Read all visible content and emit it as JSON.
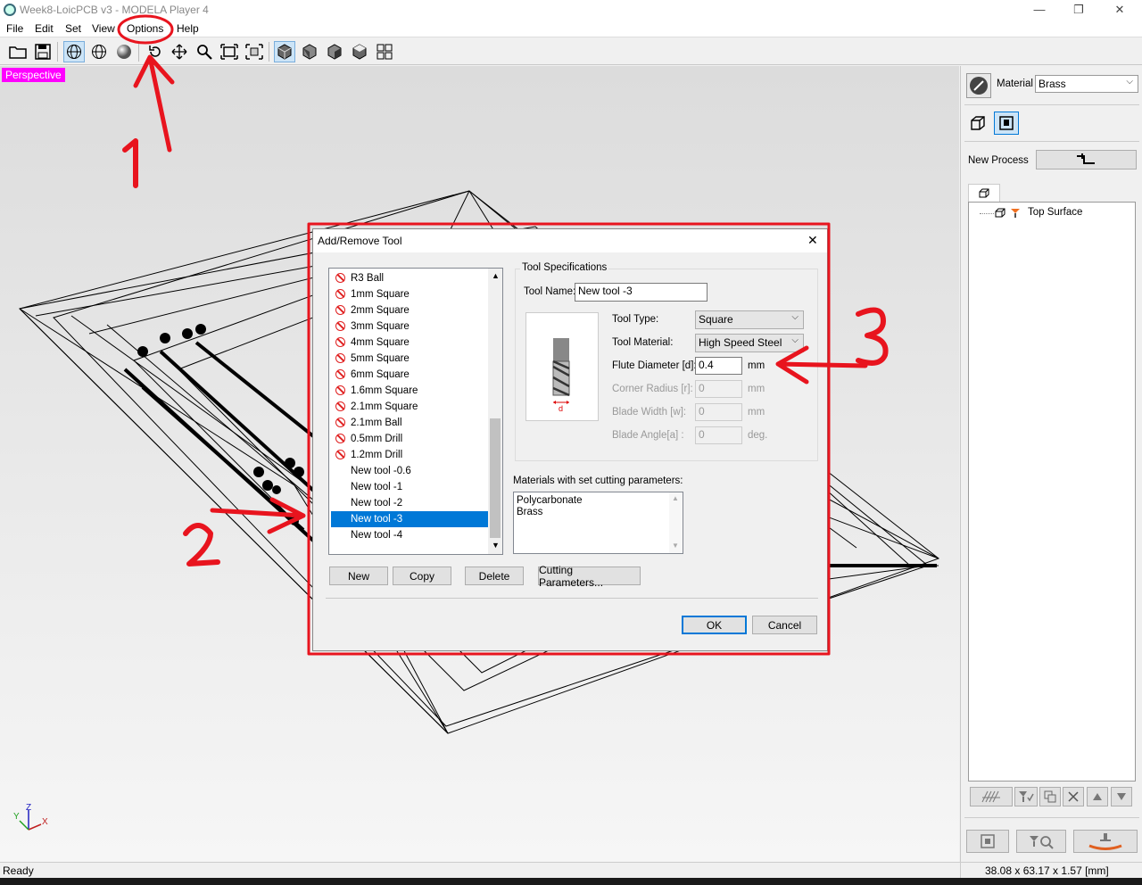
{
  "window": {
    "title": "Week8-LoicPCB v3 - MODELA Player 4",
    "controls": [
      "—",
      "❐",
      "✕"
    ]
  },
  "menu": [
    "File",
    "Edit",
    "Set",
    "View",
    "Options",
    "Help"
  ],
  "viewport": {
    "view_label": "Perspective",
    "axes": {
      "x": "X",
      "y": "Y",
      "z": "Z"
    }
  },
  "right_panel": {
    "material_label": "Material",
    "material_value": "Brass",
    "new_process_label": "New Process",
    "process_tree": [
      "Top Surface"
    ]
  },
  "dialog": {
    "title": "Add/Remove Tool",
    "close": "✕",
    "tools": [
      {
        "name": "R3 Ball",
        "restricted": true
      },
      {
        "name": "1mm Square",
        "restricted": true
      },
      {
        "name": "2mm Square",
        "restricted": true
      },
      {
        "name": "3mm Square",
        "restricted": true
      },
      {
        "name": "4mm Square",
        "restricted": true
      },
      {
        "name": "5mm Square",
        "restricted": true
      },
      {
        "name": "6mm Square",
        "restricted": true
      },
      {
        "name": "1.6mm Square",
        "restricted": true
      },
      {
        "name": "2.1mm Square",
        "restricted": true
      },
      {
        "name": "2.1mm Ball",
        "restricted": true
      },
      {
        "name": "0.5mm Drill",
        "restricted": true
      },
      {
        "name": "1.2mm Drill",
        "restricted": true
      },
      {
        "name": "New tool -0.6",
        "restricted": false
      },
      {
        "name": "New tool -1",
        "restricted": false
      },
      {
        "name": "New tool -2",
        "restricted": false
      },
      {
        "name": "New tool -3",
        "restricted": false,
        "selected": true
      },
      {
        "name": "New tool -4",
        "restricted": false
      }
    ],
    "spec_group": "Tool Specifications",
    "tool_name_label": "Tool Name:",
    "tool_name_value": "New tool -3",
    "tool_type_label": "Tool Type:",
    "tool_type_value": "Square",
    "tool_material_label": "Tool Material:",
    "tool_material_value": "High Speed Steel",
    "flute_label": "Flute Diameter [d]:",
    "flute_value": "0.4",
    "flute_unit": "mm",
    "corner_label": "Corner Radius [r]:",
    "corner_value": "0",
    "corner_unit": "mm",
    "blade_width_label": "Blade Width [w]:",
    "blade_width_value": "0",
    "blade_width_unit": "mm",
    "blade_angle_label": "Blade Angle[a] :",
    "blade_angle_value": "0",
    "blade_angle_unit": "deg.",
    "diagram_label": "d",
    "materials_label": "Materials with set cutting parameters:",
    "materials": [
      "Polycarbonate",
      "Brass"
    ],
    "buttons": {
      "new": "New",
      "copy": "Copy",
      "delete": "Delete",
      "cutting": "Cutting Parameters...",
      "ok": "OK",
      "cancel": "Cancel"
    }
  },
  "annotations": [
    "1",
    "2",
    "3"
  ],
  "status": {
    "left": "Ready",
    "right": "38.08 x 63.17 x 1.57 [mm]"
  },
  "colors": {
    "accent": "#0078d7",
    "annotation": "#e8141e",
    "view_label_bg": "#ff00ff"
  }
}
